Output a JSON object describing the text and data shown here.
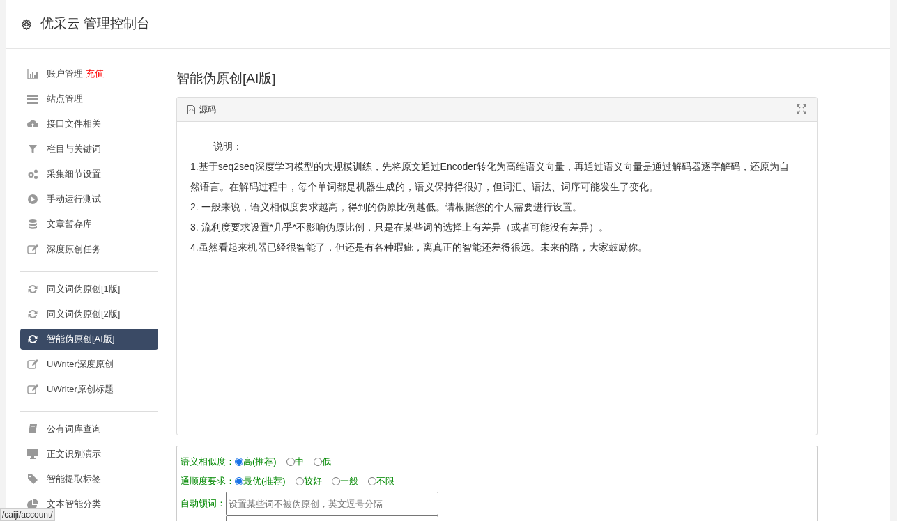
{
  "header": {
    "title": "优采云 管理控制台"
  },
  "sidebar": {
    "groups": [
      [
        {
          "label": "账户管理",
          "badge": "充值",
          "selected": false
        },
        {
          "label": "站点管理",
          "selected": false
        },
        {
          "label": "接口文件相关",
          "selected": false
        },
        {
          "label": "栏目与关键词",
          "selected": false
        },
        {
          "label": "采集细节设置",
          "selected": false
        },
        {
          "label": "手动运行测试",
          "selected": false
        },
        {
          "label": "文章暂存库",
          "selected": false
        },
        {
          "label": "深度原创任务",
          "selected": false
        }
      ],
      [
        {
          "label": "同义词伪原创[1版]",
          "selected": false
        },
        {
          "label": "同义词伪原创[2版]",
          "selected": false
        },
        {
          "label": "智能伪原创[AI版]",
          "selected": true
        },
        {
          "label": "UWriter深度原创",
          "selected": false
        },
        {
          "label": "UWriter原创标题",
          "selected": false
        }
      ],
      [
        {
          "label": "公有词库查询",
          "selected": false
        },
        {
          "label": "正文识别演示",
          "selected": false
        },
        {
          "label": "智能提取标签",
          "selected": false
        },
        {
          "label": "文本智能分类",
          "selected": false
        }
      ]
    ]
  },
  "main": {
    "title": "智能伪原创[AI版]",
    "editor": {
      "tab": "源码",
      "paragraphs": [
        "说明：",
        "1.基于seq2seq深度学习模型的大规模训练，先将原文通过Encoder转化为高维语义向量，再通过语义向量是通过解码器逐字解码，还原为自然语言。在解码过程中，每个单词都是机器生成的，语义保持得很好，但词汇、语法、词序可能发生了变化。",
        "2. 一般来说，语义相似度要求越高，得到的伪原比例越低。请根据您的个人需要进行设置。",
        "3. 流利度要求设置*几乎*不影响伪原比例，只是在某些词的选择上有差异（或者可能没有差异）。",
        "4.虽然看起来机器已经很智能了，但还是有各种瑕疵，离真正的智能还差得很远。未来的路，大家鼓励你。"
      ]
    },
    "options": [
      {
        "label": "语义相似度：",
        "choices": [
          {
            "label": "高(推荐)",
            "selected": true
          },
          {
            "label": "中",
            "selected": false
          },
          {
            "label": "低",
            "selected": false
          }
        ]
      },
      {
        "label": "通顺度要求：",
        "choices": [
          {
            "label": "最优(推荐)",
            "selected": true
          },
          {
            "label": "较好",
            "selected": false
          },
          {
            "label": "一般",
            "selected": false
          },
          {
            "label": "不限",
            "selected": false
          }
        ]
      }
    ],
    "lock_words": {
      "label": "自动锁词：",
      "placeholder": "设置某些词不被伪原创，英文逗号分隔"
    }
  },
  "status_url": "/caiji/account/"
}
